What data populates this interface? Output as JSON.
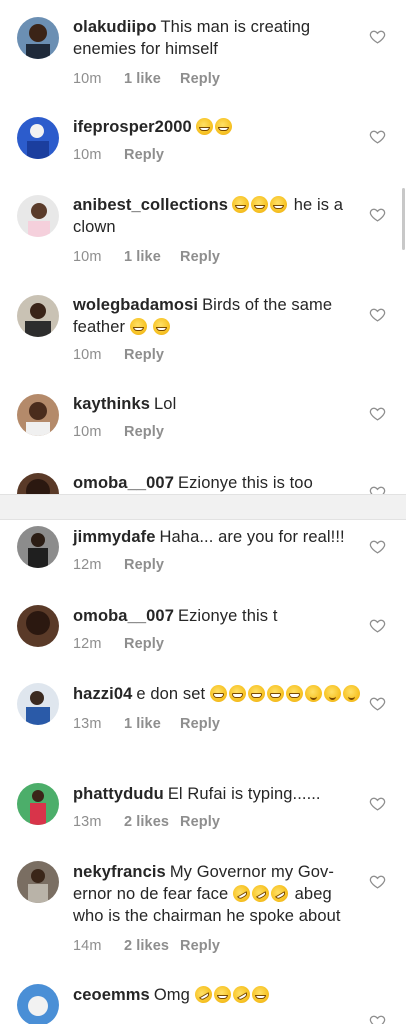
{
  "labels": {
    "reply": "Reply"
  },
  "colors": {
    "text": "#262626",
    "meta": "#8e8e8e",
    "divider": "#f1f1f1",
    "heart_outline": "#8e8e8e"
  },
  "icons": {
    "like": "heart-outline-icon"
  },
  "comments_top": [
    {
      "user": "olakudiipo",
      "text": "This man is creating enemies for himself",
      "time": "10m",
      "likes": "1 like"
    },
    {
      "user": "ifeprosper2000",
      "text": "",
      "emojis": [
        "joy",
        "joy"
      ],
      "time": "10m",
      "likes": ""
    },
    {
      "user": "anibest_collections",
      "text_before": "",
      "emojis": [
        "joy",
        "joy",
        "joy"
      ],
      "text": "he is a clown",
      "time": "10m",
      "likes": "1 like"
    },
    {
      "user": "wolegbadamosi",
      "text": "Birds of the same feather",
      "emojis": [
        "joy",
        "joy"
      ],
      "time": "10m",
      "likes": ""
    },
    {
      "user": "kaythinks",
      "text": "Lol",
      "time": "10m",
      "likes": ""
    },
    {
      "user": "omoba__007",
      "text": "Ezionye this is too",
      "time": "",
      "likes": ""
    }
  ],
  "comments_bottom": [
    {
      "user": "jimmydafe",
      "text": "Haha... are you for real!!!",
      "time": "12m",
      "likes": ""
    },
    {
      "user": "omoba__007",
      "text": "Ezionye this t",
      "time": "12m",
      "likes": ""
    },
    {
      "user": "hazzi04",
      "text": "e don set",
      "emojis": [
        "grin",
        "grin",
        "grin",
        "grin",
        "grin",
        "wink",
        "wink",
        "wink"
      ],
      "time": "13m",
      "likes": "1 like"
    },
    {
      "user": "phattydudu",
      "text": "El Rufai is typing......",
      "time": "13m",
      "likes": "2 likes"
    },
    {
      "user": "nekyfrancis",
      "text_a": "My Governor my Gov-ernor no de fear face",
      "emojis": [
        "rofl",
        "rofl",
        "rofl"
      ],
      "text_b": "abeg who is the chairman he spoke about",
      "time": "14m",
      "likes": "2 likes"
    },
    {
      "user": "ceoemms",
      "text": "Omg",
      "emojis": [
        "rofl",
        "joy",
        "rofl",
        "joy"
      ],
      "time": "",
      "likes": ""
    }
  ]
}
